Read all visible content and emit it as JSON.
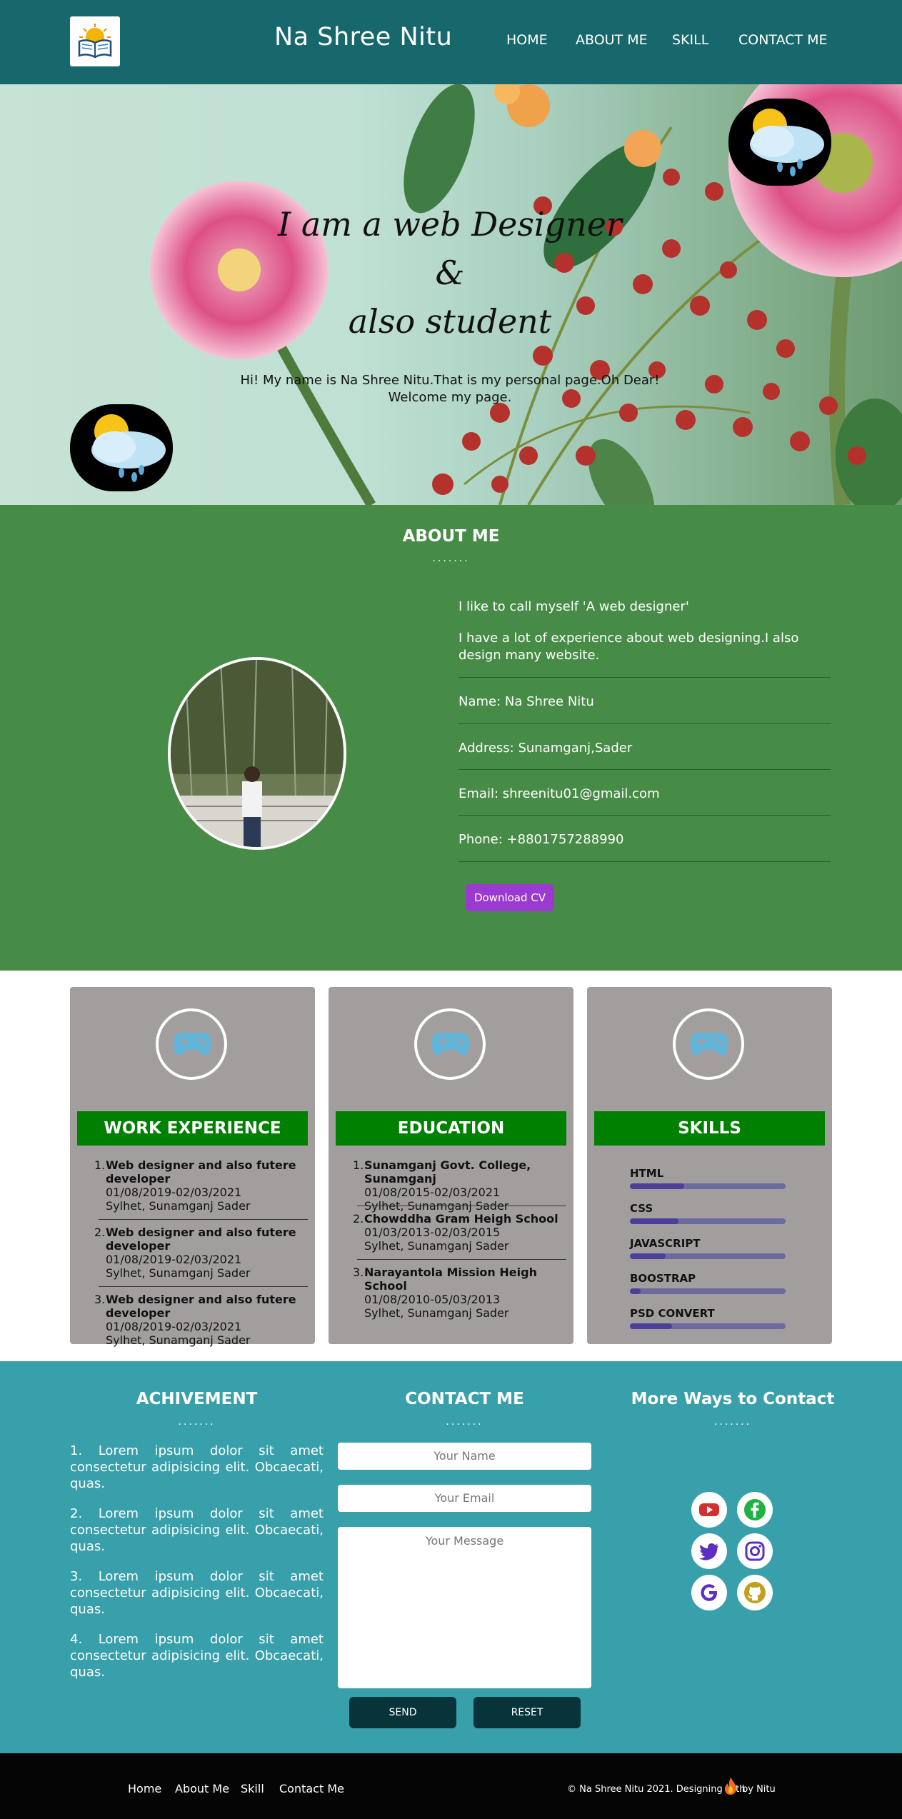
{
  "nav": {
    "brand": "Na Shree Nitu",
    "links": [
      "HOME",
      "ABOUT ME",
      "SKILL",
      "CONTACT ME"
    ]
  },
  "hero": {
    "line1": "I am a web Designer",
    "line2": "&",
    "line3": "also student",
    "sub1": "Hi! My name is Na Shree Nitu.That is my personal page.Oh Dear!",
    "sub2": "Welcome my page."
  },
  "about": {
    "title": "ABOUT ME",
    "dots": ".......",
    "intro1": "I like to call myself 'A web designer'",
    "intro2": "I have a lot of experience about web designing.I also design many website.",
    "name": "Name: Na Shree Nitu",
    "address": "Address: Sunamganj,Sader",
    "email": "Email: shreenitu01@gmail.com",
    "phone": "Phone: +8801757288990",
    "cv_button": "Download CV"
  },
  "cards": {
    "work": {
      "title": "WORK EXPERIENCE",
      "items": [
        {
          "num": "1.",
          "title": "Web designer and also futere developer",
          "date": "01/08/2019-02/03/2021",
          "place": "Sylhet, Sunamganj Sader"
        },
        {
          "num": "2.",
          "title": "Web designer and also futere developer",
          "date": "01/08/2019-02/03/2021",
          "place": "Sylhet, Sunamganj Sader"
        },
        {
          "num": "3.",
          "title": "Web designer and also futere developer",
          "date": "01/08/2019-02/03/2021",
          "place": "Sylhet, Sunamganj Sader"
        }
      ]
    },
    "education": {
      "title": "EDUCATION",
      "items": [
        {
          "num": "1.",
          "title": "Sunamganj Govt. College, Sunamganj",
          "date": "01/08/2015-02/03/2021",
          "place": "Sylhet, Sunamganj Sader"
        },
        {
          "num": "2.",
          "title": "Chowddha Gram Heigh School",
          "date": "01/03/2013-02/03/2015",
          "place": "Sylhet, Sunamganj Sader"
        },
        {
          "num": "3.",
          "title": "Narayantola Mission Heigh School",
          "date": "01/08/2010-05/03/2013",
          "place": "Sylhet, Sunamganj Sader"
        }
      ]
    },
    "skills": {
      "title": "SKILLS",
      "items": [
        {
          "name": "HTML",
          "level": 0.35
        },
        {
          "name": "CSS",
          "level": 0.31
        },
        {
          "name": "JAVASCRIPT",
          "level": 0.23
        },
        {
          "name": "BOOSTRAP",
          "level": 0.07
        },
        {
          "name": "PSD CONVERT",
          "level": 0.27
        }
      ]
    }
  },
  "contact": {
    "achievement_title": "ACHIVEMENT",
    "contact_title": "CONTACT ME",
    "more_title": "More Ways to Contact",
    "dots": ".......",
    "achievements": [
      "1. Lorem ipsum dolor sit amet consectetur adipisicing elit. Obcaecati, quas.",
      "2. Lorem ipsum dolor sit amet consectetur adipisicing elit. Obcaecati, quas.",
      "3. Lorem ipsum dolor sit amet consectetur adipisicing elit. Obcaecati, quas.",
      "4. Lorem ipsum dolor sit amet consectetur adipisicing elit. Obcaecati, quas."
    ],
    "name_placeholder": "Your Name",
    "email_placeholder": "Your Email",
    "message_placeholder": "Your Message",
    "send": "SEND",
    "reset": "RESET",
    "socials": [
      "youtube-icon",
      "facebook-icon",
      "twitter-icon",
      "instagram-icon",
      "google-icon",
      "github-icon"
    ]
  },
  "footer": {
    "links": [
      "Home",
      "About Me",
      "Skill",
      "Contact Me"
    ],
    "copy_prefix": "© Na Shree Nitu 2021. Designing with",
    "copy_suffix": "by Nitu"
  },
  "colors": {
    "nav": "#17686d",
    "about_bg": "#478c46",
    "card_bg": "#a39e9e",
    "card_head": "#008000",
    "contact_bg": "#38a0ab",
    "cv_button": "#9b3ad0",
    "footer": "#050505"
  }
}
